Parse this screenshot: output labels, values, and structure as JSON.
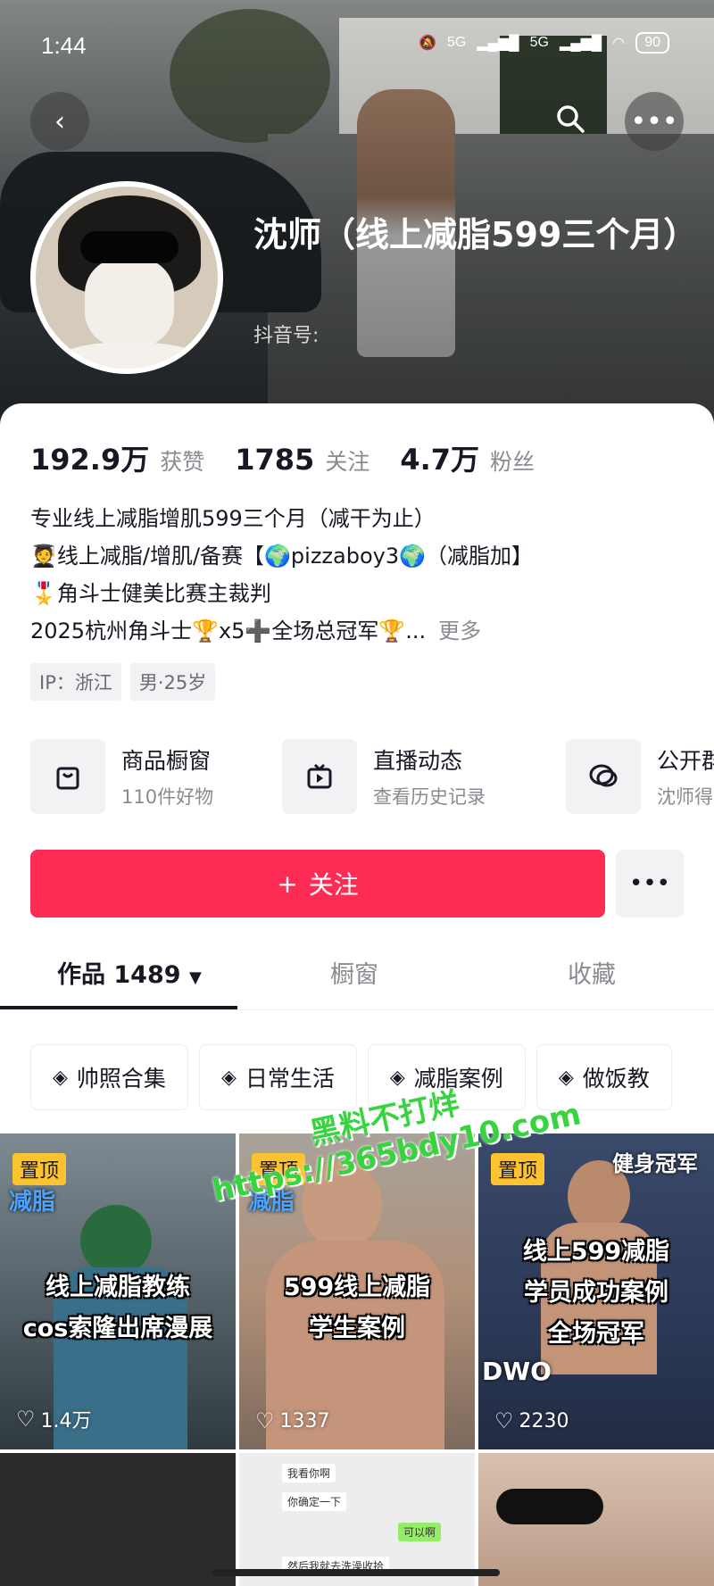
{
  "status_bar": {
    "time": "1:44",
    "network1": "5G",
    "network2": "5G",
    "battery": "90"
  },
  "profile": {
    "name": "沈师（线上减脂599三个月）",
    "douyin_id_label": "抖音号:"
  },
  "stats": {
    "likes_value": "192.9万",
    "likes_label": "获赞",
    "following_value": "1785",
    "following_label": "关注",
    "followers_value": "4.7万",
    "followers_label": "粉丝"
  },
  "bio": {
    "line1": "专业线上减脂增肌599三个月（减干为止）",
    "line2": "🧑‍🎓线上减脂/增肌/备赛【🌍pizzaboy3🌍（减脂加】",
    "line3": "🎖️角斗士健美比赛主裁判",
    "line4": "2025杭州角斗士🏆x5➕全场总冠军🏆...",
    "more": "更多"
  },
  "tags": {
    "ip": "IP：浙江",
    "gender_age": "男·25岁"
  },
  "features": [
    {
      "title": "商品橱窗",
      "subtitle": "110件好物",
      "icon": "shopping-bag-icon"
    },
    {
      "title": "直播动态",
      "subtitle": "查看历史记录",
      "icon": "tv-icon"
    },
    {
      "title": "公开群",
      "subtitle": "沈师得",
      "icon": "chat-bubbles-icon"
    }
  ],
  "follow_button": {
    "label": "关注",
    "plus": "+"
  },
  "tabs": {
    "works": "作品 1489",
    "showcase": "橱窗",
    "favorites": "收藏"
  },
  "collections": [
    "帅照合集",
    "日常生活",
    "减脂案例",
    "做饭教"
  ],
  "videos": [
    {
      "pinned": "置顶",
      "caption1": "线上减脂教练",
      "caption2": "cos索隆出席漫展",
      "likes": "1.4万",
      "overlay": "减脂"
    },
    {
      "pinned": "置顶",
      "caption1": "599线上减脂",
      "caption2": "学生案例",
      "likes": "1337",
      "overlay": "减脂"
    },
    {
      "pinned": "置顶",
      "caption1": "线上599减脂",
      "caption2": "学员成功案例",
      "caption3": "全场冠军",
      "likes": "2230",
      "overlay": "健身冠军",
      "overlay2": "DWO"
    }
  ],
  "chat_preview": [
    "我看你啊",
    "你确定一下",
    "可以啊",
    "然后我就去洗澡收拾"
  ],
  "watermark": {
    "line1": "黑料不打烊",
    "line2": "https://365bdy10.com"
  },
  "colors": {
    "accent": "#fe2c55",
    "pin": "#fcc331"
  }
}
